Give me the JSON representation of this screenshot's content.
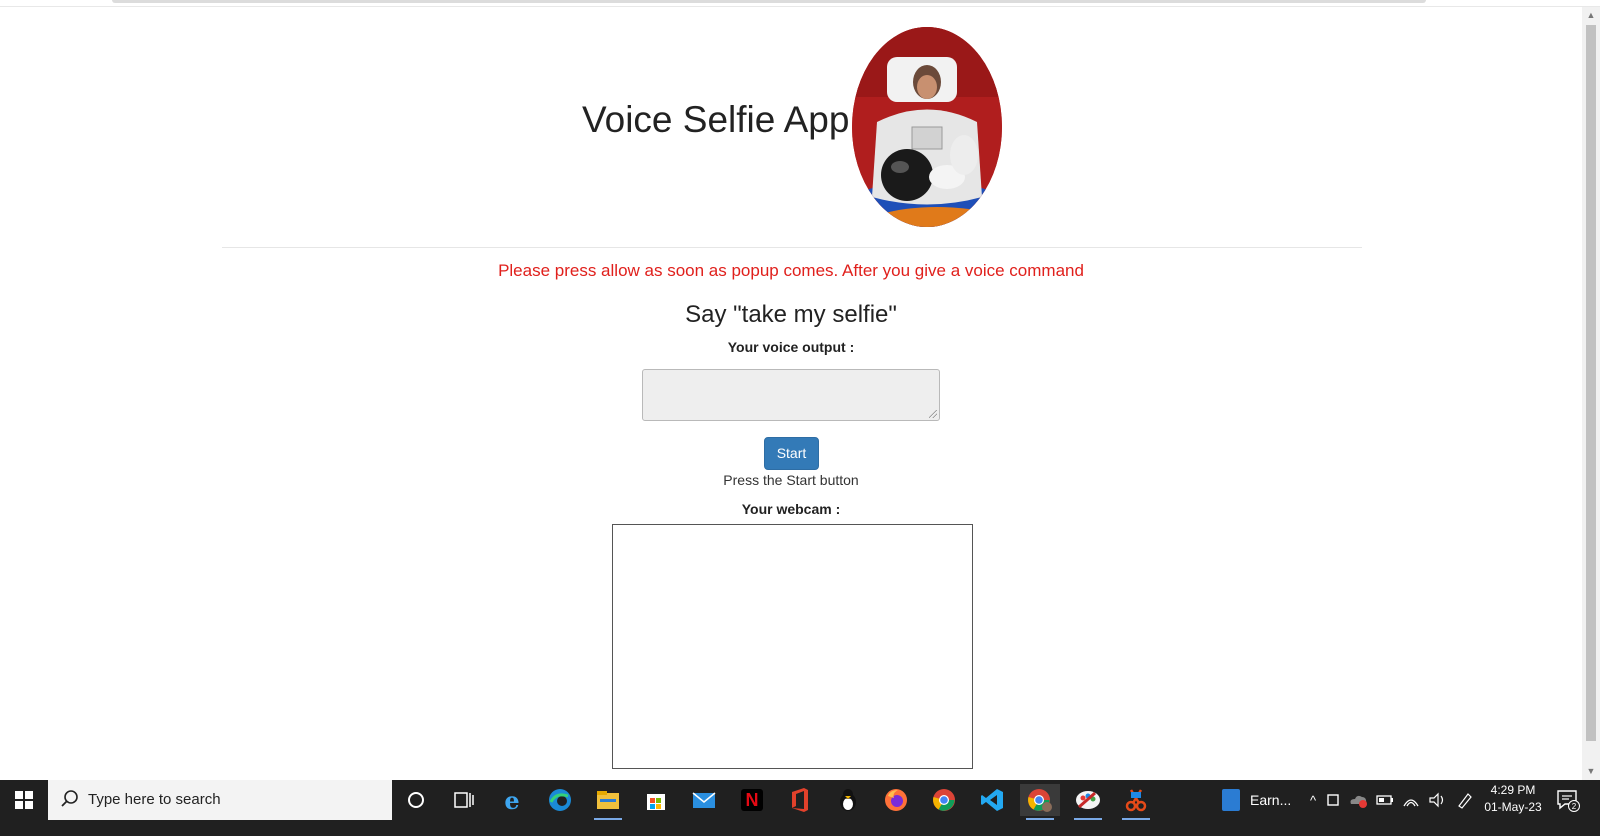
{
  "page": {
    "title": "Voice Selfie App",
    "notice": "Please press allow as soon as popup comes. After you give a voice command",
    "instruction": "Say \"take my selfie\"",
    "voice_label": "Your voice output :",
    "voice_value": "",
    "start_label": "Start",
    "status_text": "Press the Start button",
    "webcam_label": "Your webcam :",
    "notice_color": "#e0201c",
    "button_color": "#337ab7"
  },
  "taskbar": {
    "search_placeholder": "Type here to search",
    "apps": [
      "cortana-icon",
      "task-view-icon",
      "internet-explorer-icon",
      "edge-icon",
      "file-explorer-icon",
      "microsoft-store-icon",
      "mail-icon",
      "netflix-icon",
      "office-icon",
      "linux-app-icon",
      "firefox-icon",
      "chrome-icon",
      "vscode-icon",
      "chrome-profile-icon",
      "paint-app-icon",
      "snipping-tool-icon"
    ],
    "pinned_window": "Earn...",
    "time": "4:29 PM",
    "date": "01-May-23",
    "notification_count": "2"
  }
}
